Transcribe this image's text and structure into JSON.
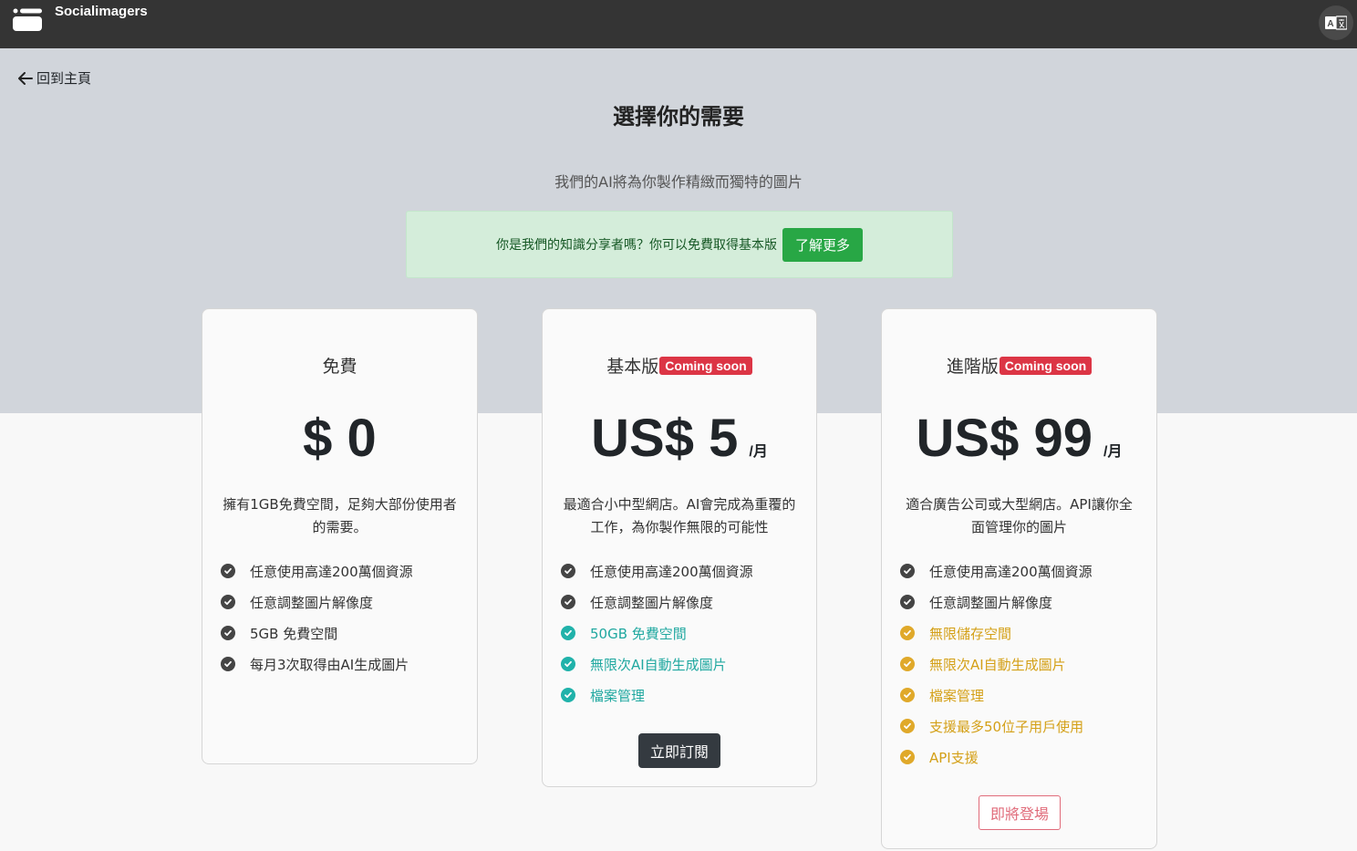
{
  "header": {
    "brand": "Socialimagers",
    "logo_icon": "logo-icon",
    "lang_icon": "translate-icon"
  },
  "nav": {
    "back_label": "回到主頁"
  },
  "page": {
    "title": "選擇你的需要",
    "subtitle": "我們的AI將為你製作精緻而獨特的圖片"
  },
  "notice": {
    "text": "你是我們的知識分享者嗎？你可以免費取得基本版",
    "button": "了解更多"
  },
  "colors": {
    "header_bg": "#343434",
    "hero_bg": "#d1d5db",
    "success": "#28a745",
    "danger": "#dc3545",
    "teal": "#20b2aa",
    "gold": "#e0a92a"
  },
  "plans": [
    {
      "name": "免費",
      "badge": "",
      "price": "$ 0",
      "period": "",
      "desc": "擁有1GB免費空間，足夠大部份使用者的需要。",
      "features": [
        "任意使用高達200萬個資源",
        "任意調整圖片解像度",
        "5GB 免費空間",
        "每月3次取得由AI生成圖片"
      ]
    },
    {
      "name": "基本版",
      "badge": "Coming soon",
      "price": "US$ 5",
      "period": "/月",
      "desc": "最適合小中型網店。AI會完成為重覆的工作，為你製作無限的可能性",
      "features": [
        "任意使用高達200萬個資源",
        "任意調整圖片解像度",
        "50GB 免費空間",
        "無限次AI自動生成圖片",
        "檔案管理"
      ],
      "button": "立即訂閱"
    },
    {
      "name": "進階版",
      "badge": "Coming soon",
      "price": "US$ 99",
      "period": "/月",
      "desc": "適合廣告公司或大型網店。API讓你全面管理你的圖片",
      "features": [
        "任意使用高達200萬個資源",
        "任意調整圖片解像度",
        "無限儲存空間",
        "無限次AI自動生成圖片",
        "檔案管理",
        "支援最多50位子用戶使用",
        "API支援"
      ],
      "button": "即將登場"
    }
  ]
}
